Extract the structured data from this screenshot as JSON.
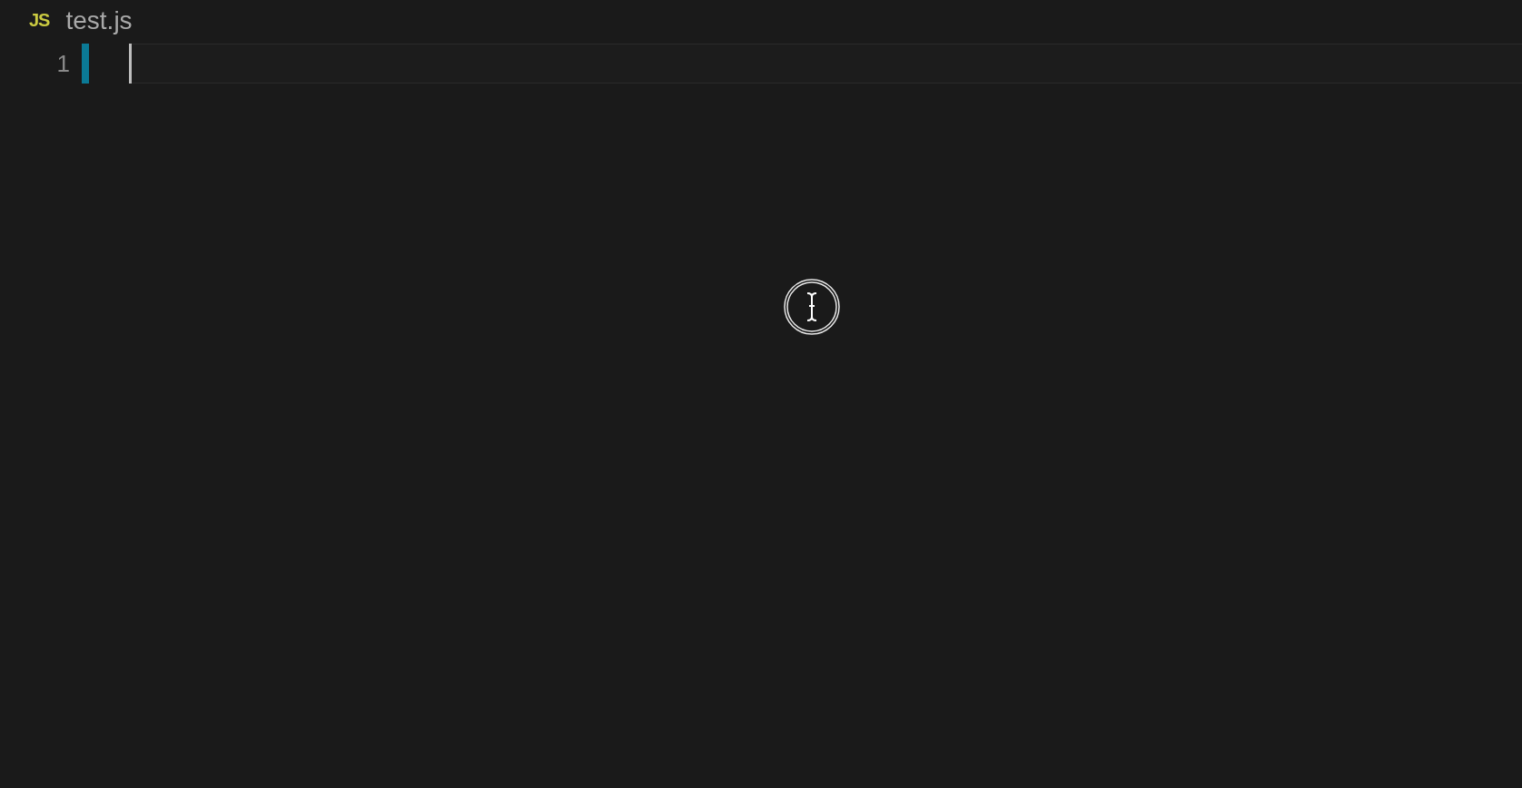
{
  "file_header": {
    "type_label": "JS",
    "file_name": "test.js"
  },
  "editor": {
    "lines": [
      {
        "number": "1",
        "changed": true,
        "current": true
      }
    ]
  }
}
